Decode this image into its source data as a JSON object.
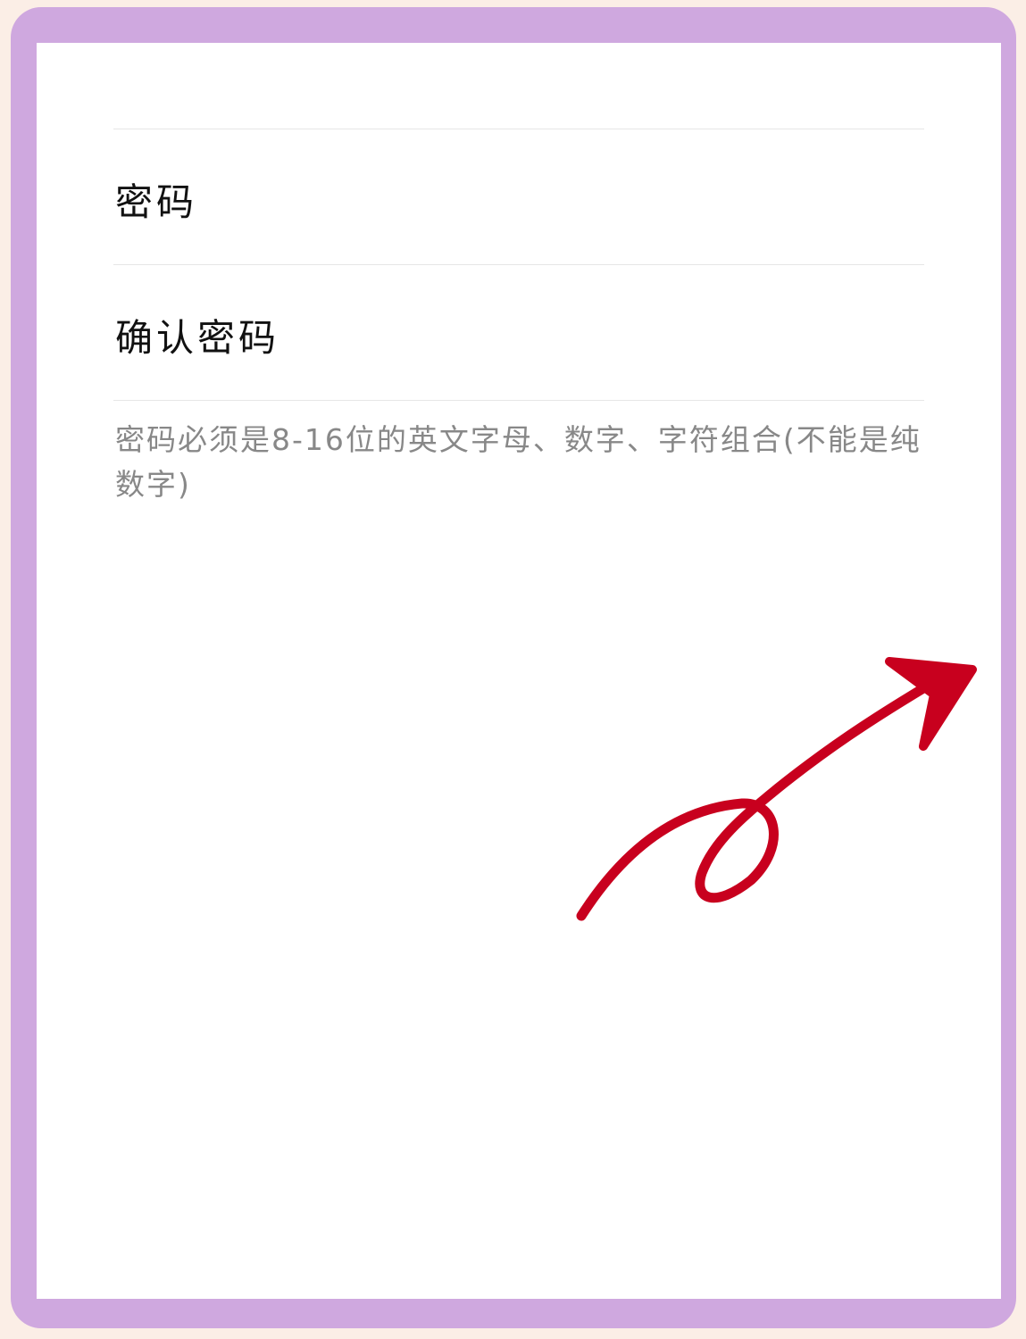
{
  "form": {
    "password_label": "密码",
    "confirm_password_label": "确认密码",
    "hint": "密码必须是8-16位的英文字母、数字、字符组合(不能是纯数字)"
  },
  "colors": {
    "frame": "#cfa8df",
    "page_background": "#fbeee6",
    "annotation_arrow": "#c8001e"
  }
}
